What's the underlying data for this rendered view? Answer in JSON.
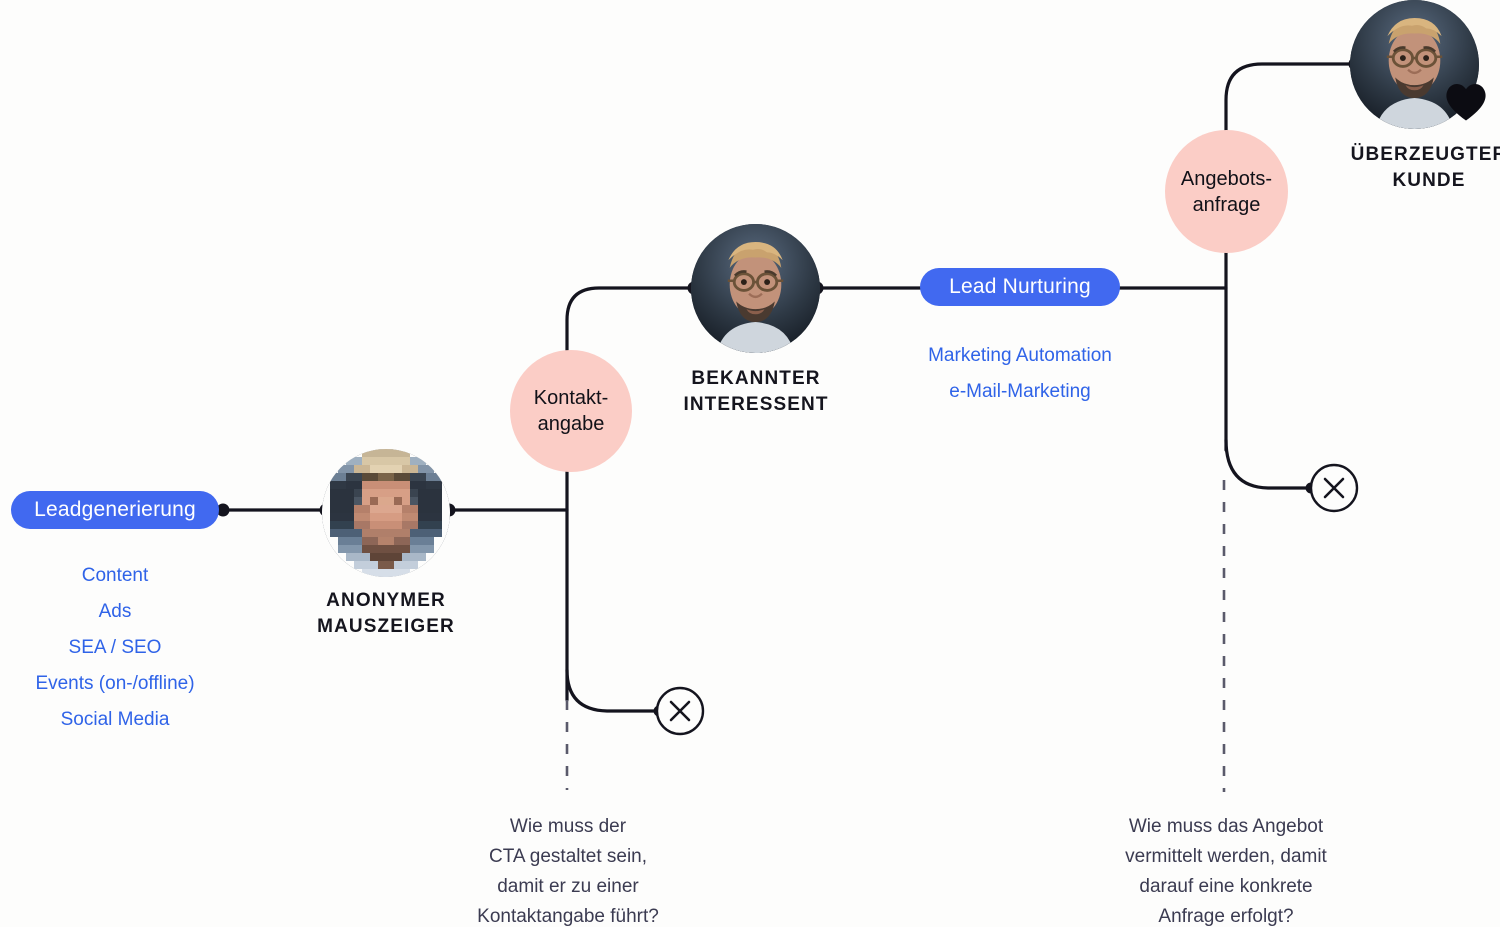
{
  "diagram": {
    "title_present": false,
    "background_color": "#fdfdfc",
    "accent_blue": "#4169f0",
    "link_blue": "#2f63e8",
    "accent_pink": "#fbcdc6",
    "line_color": "#14141e"
  },
  "stages": {
    "leadgen": {
      "pill_label": "Leadgenerierung",
      "channels": [
        "Content",
        "Ads",
        "SEA / SEO",
        "Events (on-/offline)",
        "Social Media"
      ]
    },
    "nurturing": {
      "pill_label": "Lead Nurturing",
      "channels": [
        "Marketing Automation",
        "e-Mail-Marketing"
      ]
    }
  },
  "conversion_points": {
    "kontakt": {
      "line1": "Kontakt-",
      "line2": "angabe"
    },
    "angebot": {
      "line1": "Angebots-",
      "line2": "anfrage"
    }
  },
  "personas": {
    "anonym": {
      "line1": "ANONYMER",
      "line2": "MAUSZEIGER",
      "avatar": "pixelated-blurred-person-avatar"
    },
    "interessent": {
      "line1": "BEKANNTER",
      "line2": "INTERESSENT",
      "avatar": "bearded-man-glasses-avatar"
    },
    "kunde": {
      "line1": "ÜBERZEUGTER",
      "line2": "KUNDE",
      "avatar": "bearded-man-glasses-avatar",
      "badge": "heart-icon"
    }
  },
  "questions": {
    "left": [
      "Wie muss der",
      "CTA gestaltet sein,",
      "damit er zu einer",
      "Kontaktangabe führt?"
    ],
    "right": [
      "Wie muss das Angebot",
      "vermittelt werden, damit",
      "darauf eine konkrete",
      "Anfrage erfolgt?"
    ]
  },
  "exits": {
    "left_glyph": "×",
    "right_glyph": "×",
    "left_name": "drop-off-exit-left",
    "right_name": "drop-off-exit-right"
  }
}
